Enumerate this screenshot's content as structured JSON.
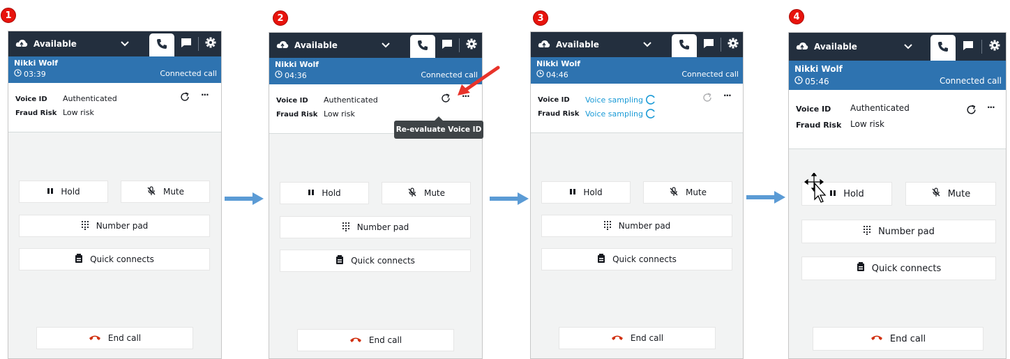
{
  "steps": [
    {
      "number": "1",
      "status": "Available",
      "caller": "Nikki Wolf",
      "timer": "03:39",
      "call_state": "Connected call",
      "voice_id_label": "Voice ID",
      "voice_id_value": "Authenticated",
      "fraud_label": "Fraud Risk",
      "fraud_value": "Low risk",
      "more": "···",
      "buttons": {
        "hold": "Hold",
        "mute": "Mute",
        "numpad": "Number pad",
        "quick": "Quick connects",
        "end": "End call"
      }
    },
    {
      "number": "2",
      "status": "Available",
      "caller": "Nikki Wolf",
      "timer": "04:36",
      "call_state": "Connected call",
      "voice_id_label": "Voice ID",
      "voice_id_value": "Authenticated",
      "fraud_label": "Fraud Risk",
      "fraud_value": "Low risk",
      "more": "···",
      "tooltip": "Re-evaluate Voice ID",
      "buttons": {
        "hold": "Hold",
        "mute": "Mute",
        "numpad": "Number pad",
        "quick": "Quick connects",
        "end": "End call"
      }
    },
    {
      "number": "3",
      "status": "Available",
      "caller": "Nikki Wolf",
      "timer": "04:46",
      "call_state": "Connected call",
      "voice_id_label": "Voice ID",
      "voice_id_value": "Voice sampling",
      "fraud_label": "Fraud Risk",
      "fraud_value": "Voice sampling",
      "more": "···",
      "buttons": {
        "hold": "Hold",
        "mute": "Mute",
        "numpad": "Number pad",
        "quick": "Quick connects",
        "end": "End call"
      }
    },
    {
      "number": "4",
      "status": "Available",
      "caller": "Nikki Wolf",
      "timer": "05:46",
      "call_state": "Connected call",
      "voice_id_label": "Voice ID",
      "voice_id_value": "Authenticated",
      "fraud_label": "Fraud Risk",
      "fraud_value": "Low risk",
      "more": "···",
      "buttons": {
        "hold": "Hold",
        "mute": "Mute",
        "numpad": "Number pad",
        "quick": "Quick connects",
        "end": "End call"
      }
    }
  ],
  "colors": {
    "badge": "#e8130c",
    "topbar": "#232f3e",
    "callbar": "#2e73b0",
    "sampling": "#1a9ad6",
    "end_call_icon": "#d13212",
    "flow_arrow": "#5b9bd5",
    "pointer_arrow": "#e8332a"
  },
  "icons": [
    "cloud-status-icon",
    "chevron-down-icon",
    "phone-icon",
    "chat-icon",
    "gear-icon",
    "clock-icon",
    "refresh-icon",
    "more-icon",
    "pause-icon",
    "mic-off-icon",
    "numpad-icon",
    "quick-connects-icon",
    "end-call-icon",
    "spinner-icon",
    "move-cursor-icon"
  ]
}
